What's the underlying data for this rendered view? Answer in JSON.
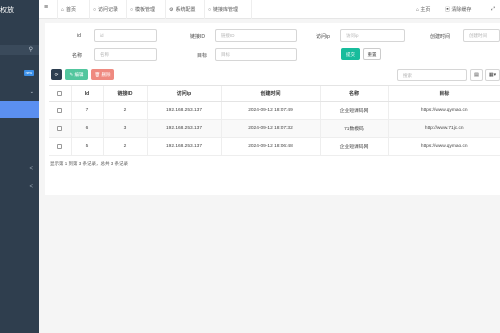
{
  "sidebar": {
    "brand": "权放",
    "new_badge": "new",
    "search_icon": "search-icon",
    "chevrons": [
      "⌄",
      "<",
      "<"
    ]
  },
  "topbar": {
    "menu_icon": "≡",
    "tabs": [
      {
        "icon": "⌂",
        "label": "首页"
      },
      {
        "icon": "○",
        "label": "访问记录"
      },
      {
        "icon": "○",
        "label": "模板管理"
      },
      {
        "icon": "⚙",
        "label": "系统配置"
      },
      {
        "icon": "○",
        "label": "链接库管理"
      }
    ],
    "right": [
      {
        "icon": "⌂",
        "label": "主页"
      },
      {
        "icon": "▣",
        "label": "清除缓存"
      },
      {
        "icon": "⤢",
        "label": ""
      }
    ]
  },
  "filters": {
    "id_label": "id",
    "id_placeholder": "id",
    "link_id_label": "链接ID",
    "link_id_placeholder": "链接ID",
    "ip_label": "访问ip",
    "ip_placeholder": "访问ip",
    "created_label": "创建时间",
    "created_placeholder": "创建时间",
    "name_label": "名称",
    "name_placeholder": "名称",
    "target_label": "目标",
    "target_placeholder": "目标",
    "submit_label": "提交",
    "reset_label": "重置"
  },
  "toolbar": {
    "refresh_icon": "⟳",
    "edit_label": "✎ 编辑",
    "delete_label": "🗑 删除",
    "search_placeholder": "搜索",
    "columns_icon": "▤",
    "export_icon": "▦▾"
  },
  "table": {
    "headers": [
      "",
      "Id",
      "链接ID",
      "访问ip",
      "创建时间",
      "名称",
      "目标"
    ],
    "rows": [
      {
        "id": "7",
        "link_id": "2",
        "ip": "192.168.253.137",
        "created": "2024-09-12 18:07:49",
        "name": "企业短课码网",
        "target": "https://www.qymao.cn"
      },
      {
        "id": "6",
        "link_id": "3",
        "ip": "192.168.253.137",
        "created": "2024-09-12 18:07:32",
        "name": "71数模码",
        "target": "http://www.71jc.cn"
      },
      {
        "id": "5",
        "link_id": "2",
        "ip": "192.168.253.137",
        "created": "2024-09-12 18:06:48",
        "name": "企业短课码网",
        "target": "https://www.qymao.cn"
      }
    ]
  },
  "pager_text": "显示第 1 到第 3 条记录，总共 3 条记录",
  "colors": {
    "sidebar": "#2f3e4e",
    "active": "#5b8ff0",
    "submit": "#18bc9c",
    "edit": "#52c69e",
    "delete": "#ef8a80",
    "refresh": "#2c3e50"
  }
}
